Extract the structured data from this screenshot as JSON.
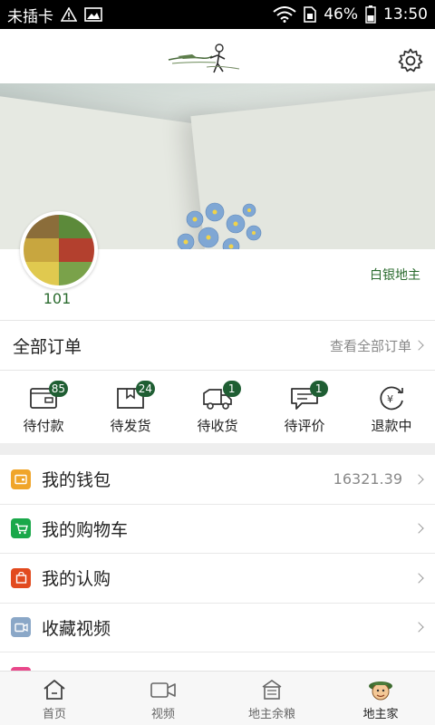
{
  "status_bar": {
    "carrier": "未插卡",
    "battery": "46%",
    "time": "13:50"
  },
  "profile": {
    "username": "101",
    "level": "白银地主"
  },
  "orders": {
    "title": "全部订单",
    "view_all": "查看全部订单",
    "items": [
      {
        "label": "待付款",
        "badge": "85",
        "icon": "wallet-icon"
      },
      {
        "label": "待发货",
        "badge": "24",
        "icon": "package-icon"
      },
      {
        "label": "待收货",
        "badge": "1",
        "icon": "truck-icon"
      },
      {
        "label": "待评价",
        "badge": "1",
        "icon": "comment-icon"
      },
      {
        "label": "退款中",
        "badge": "",
        "icon": "refund-icon"
      }
    ]
  },
  "menu": [
    {
      "label": "我的钱包",
      "value": "16321.39",
      "icon": "wallet-icon",
      "color": "#f0a52a"
    },
    {
      "label": "我的购物车",
      "value": "",
      "icon": "cart-icon",
      "color": "#1aa84a"
    },
    {
      "label": "我的认购",
      "value": "",
      "icon": "bag-icon",
      "color": "#e24a1e"
    },
    {
      "label": "收藏视频",
      "value": "",
      "icon": "video-icon",
      "color": "#8aa7c7"
    }
  ],
  "tabs": [
    {
      "label": "首页",
      "icon": "home-icon"
    },
    {
      "label": "视频",
      "icon": "video-camera-icon"
    },
    {
      "label": "地主余粮",
      "icon": "granary-icon"
    },
    {
      "label": "地主家",
      "icon": "farmer-avatar-icon",
      "active": true
    }
  ],
  "colors": {
    "accent": "#1f5e33",
    "level_text": "#2a6b2e"
  }
}
